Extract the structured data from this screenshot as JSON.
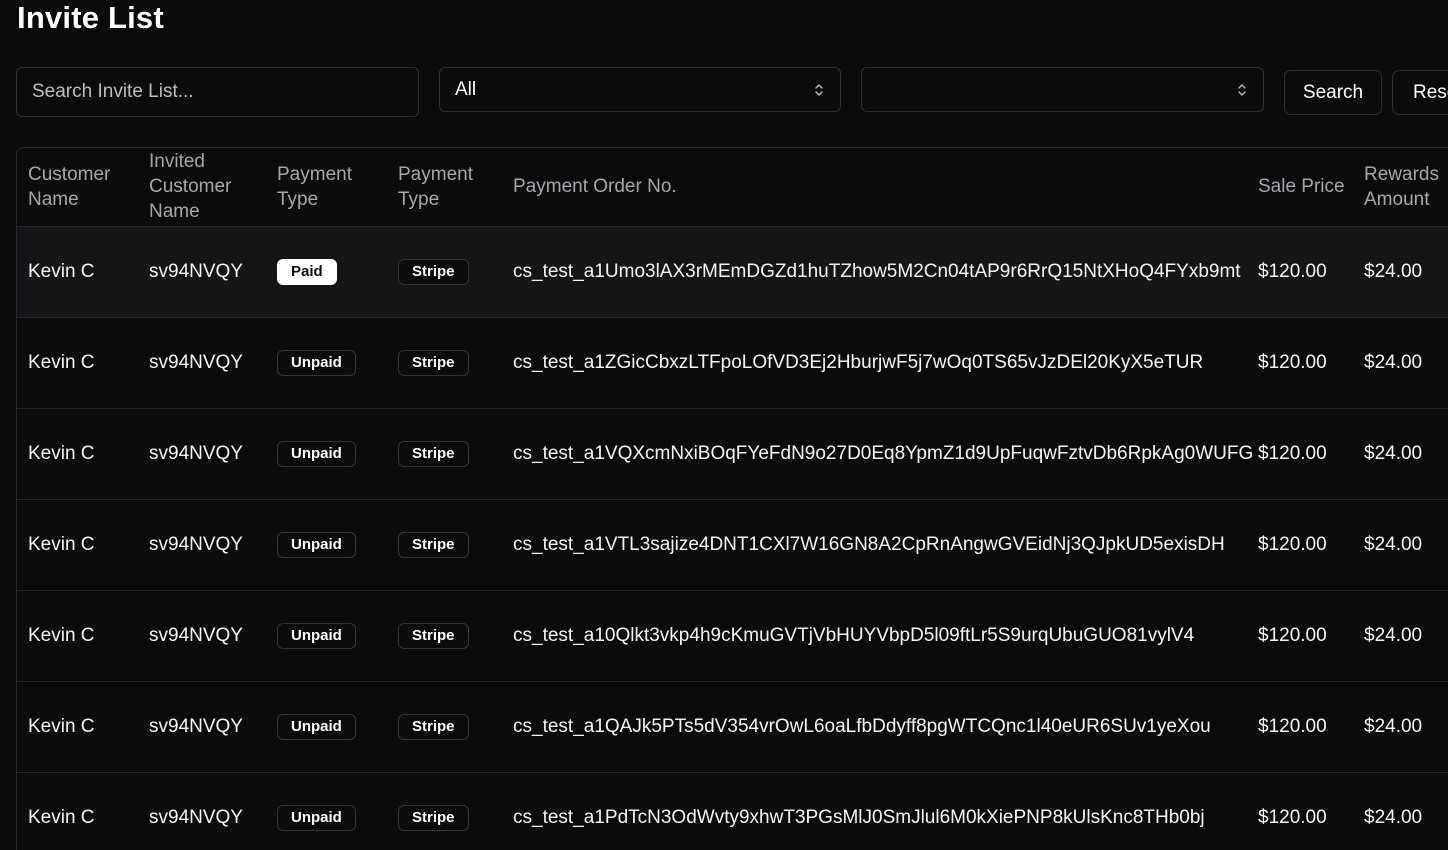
{
  "page": {
    "title": "Invite List"
  },
  "toolbar": {
    "search_placeholder": "Search Invite List...",
    "select_1_value": "All",
    "select_2_value": "",
    "search_label": "Search",
    "reset_label": "Reset"
  },
  "table": {
    "headers": {
      "customer_name": "Customer Name",
      "invited_customer_name": "Invited Customer Name",
      "payment_type": "Payment Type",
      "payment_method": "Payment Type",
      "order_no": "Payment Order No.",
      "sale_price": "Sale Price",
      "rewards_amount": "Rewards Amount"
    },
    "rows": [
      {
        "customer": "Kevin C",
        "invited": "sv94NVQY",
        "status": "Paid",
        "method": "Stripe",
        "order": "cs_test_a1Umo3lAX3rMEmDGZd1huTZhow5M2Cn04tAP9r6RrQ15NtXHoQ4FYxb9mt",
        "sale": "$120.00",
        "reward": "$24.00"
      },
      {
        "customer": "Kevin C",
        "invited": "sv94NVQY",
        "status": "Unpaid",
        "method": "Stripe",
        "order": "cs_test_a1ZGicCbxzLTFpoLOfVD3Ej2HburjwF5j7wOq0TS65vJzDEl20KyX5eTUR",
        "sale": "$120.00",
        "reward": "$24.00"
      },
      {
        "customer": "Kevin C",
        "invited": "sv94NVQY",
        "status": "Unpaid",
        "method": "Stripe",
        "order": "cs_test_a1VQXcmNxiBOqFYeFdN9o27D0Eq8YpmZ1d9UpFuqwFztvDb6RpkAg0WUFG",
        "sale": "$120.00",
        "reward": "$24.00"
      },
      {
        "customer": "Kevin C",
        "invited": "sv94NVQY",
        "status": "Unpaid",
        "method": "Stripe",
        "order": "cs_test_a1VTL3sajize4DNT1CXl7W16GN8A2CpRnAngwGVEidNj3QJpkUD5exisDH",
        "sale": "$120.00",
        "reward": "$24.00"
      },
      {
        "customer": "Kevin C",
        "invited": "sv94NVQY",
        "status": "Unpaid",
        "method": "Stripe",
        "order": "cs_test_a10Qlkt3vkp4h9cKmuGVTjVbHUYVbpD5l09ftLr5S9urqUbuGUO81vylV4",
        "sale": "$120.00",
        "reward": "$24.00"
      },
      {
        "customer": "Kevin C",
        "invited": "sv94NVQY",
        "status": "Unpaid",
        "method": "Stripe",
        "order": "cs_test_a1QAJk5PTs5dV354vrOwL6oaLfbDdyff8pgWTCQnc1l40eUR6SUv1yeXou",
        "sale": "$120.00",
        "reward": "$24.00"
      },
      {
        "customer": "Kevin C",
        "invited": "sv94NVQY",
        "status": "Unpaid",
        "method": "Stripe",
        "order": "cs_test_a1PdTcN3OdWvty9xhwT3PGsMlJ0SmJlul6M0kXiePNP8kUlsKnc8THb0bj",
        "sale": "$120.00",
        "reward": "$24.00"
      }
    ]
  },
  "colors": {
    "background": "#0b0b0c",
    "border": "#2a2a2f",
    "paid_badge_bg": "#ffffff",
    "header_text": "#a7a7ae"
  }
}
